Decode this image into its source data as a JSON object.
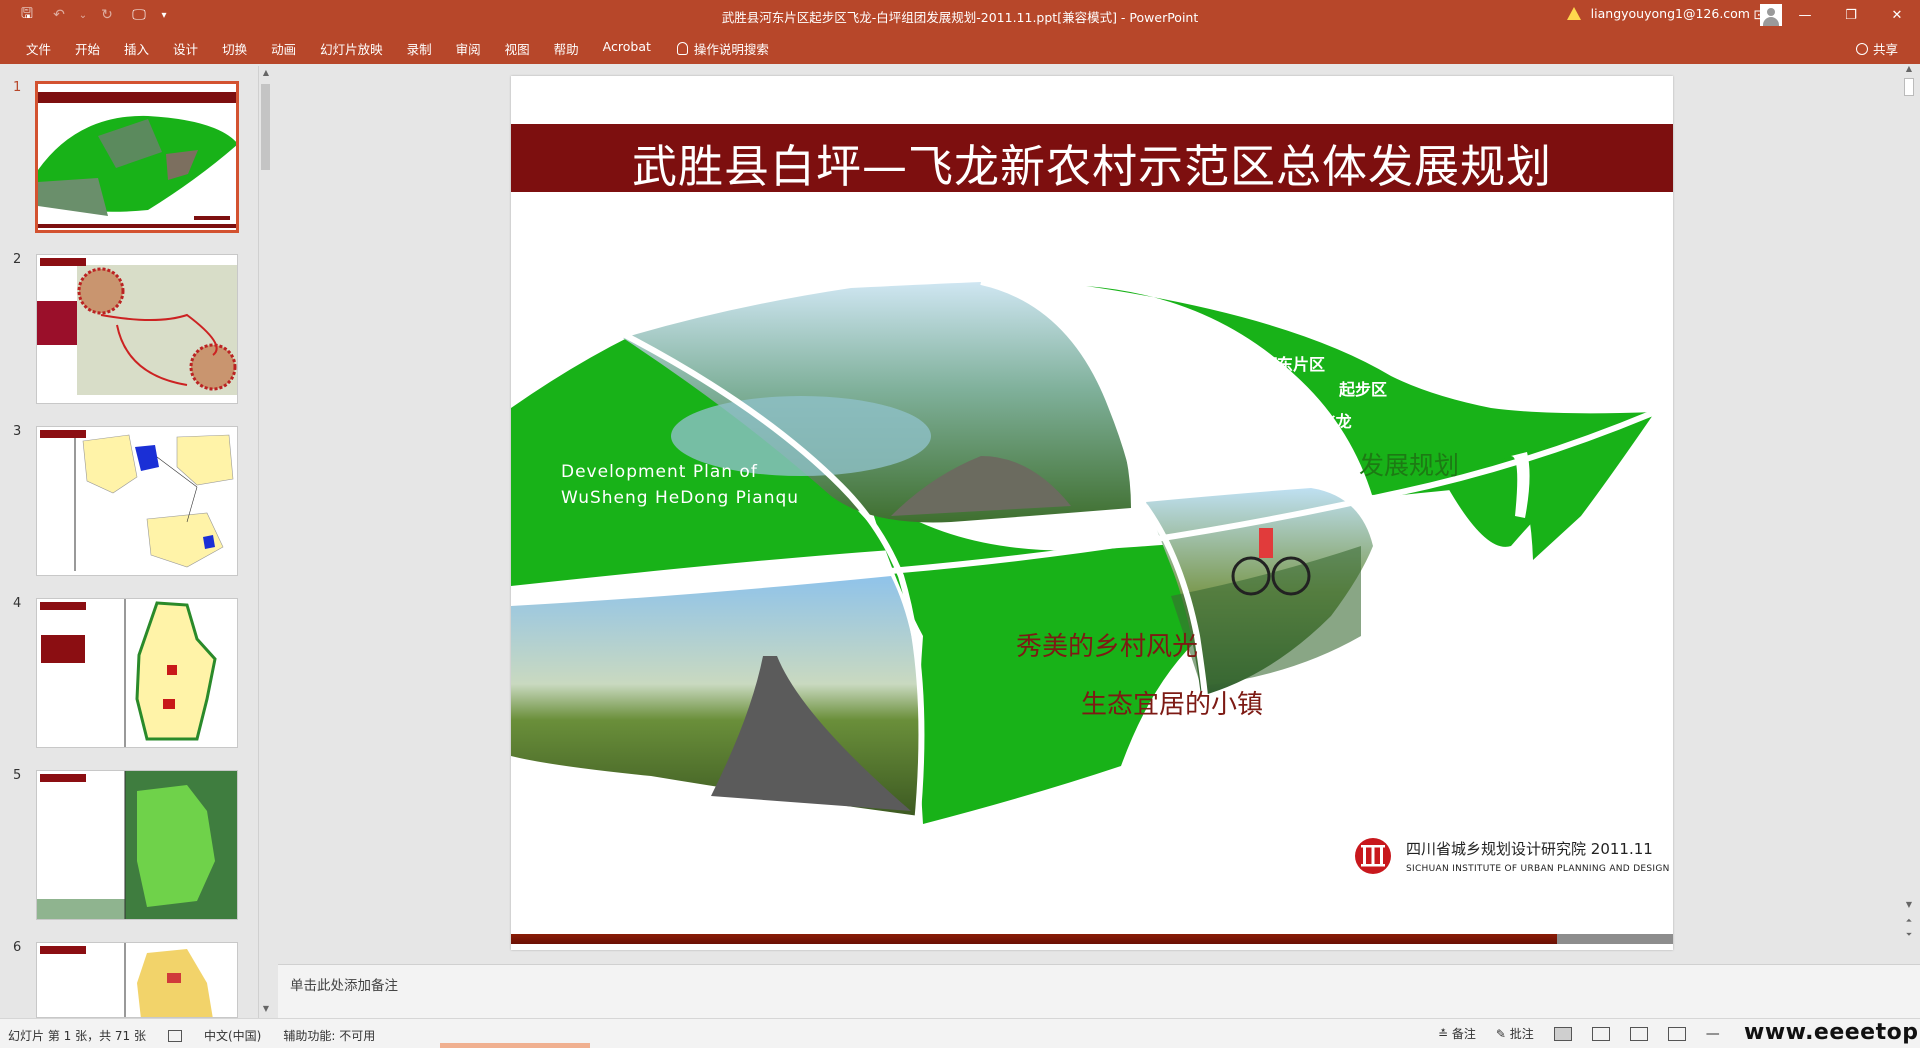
{
  "window": {
    "title": "武胜县河东片区起步区飞龙-白坪组团发展规划-2011.11.ppt[兼容模式] - PowerPoint",
    "account": "liangyouyong1@126.com",
    "controls": [
      "⊡",
      "—",
      "❐",
      "✕"
    ]
  },
  "qat": {
    "save": "🖫",
    "undo": "↶",
    "undo_more": "⌄",
    "redo": "↻",
    "from_beginning": "🖵",
    "customize": "▾"
  },
  "ribbon": {
    "tabs": [
      "文件",
      "开始",
      "插入",
      "设计",
      "切换",
      "动画",
      "幻灯片放映",
      "录制",
      "审阅",
      "视图",
      "帮助",
      "Acrobat"
    ],
    "tell_me": "操作说明搜索",
    "share": "共享"
  },
  "thumbnails": [
    {
      "num": "1",
      "selected": true
    },
    {
      "num": "2"
    },
    {
      "num": "3"
    },
    {
      "num": "4"
    },
    {
      "num": "5"
    },
    {
      "num": "6"
    }
  ],
  "slide": {
    "title": "武胜县白坪—飞龙新农村示范区总体发展规划",
    "en_line1": "Development  Plan  of",
    "en_line2": "WuSheng  HeDong  Pianqu",
    "cn_line1": "武胜县河东片区",
    "cn_line2": "起步区",
    "cn_line3": "白坪-飞龙",
    "cn_line4": "发展规划",
    "slogan1": "秀美的乡村风光",
    "slogan2": "生态宜居的小镇",
    "org": "四川省城乡规划设计研究院 2011.11",
    "org_en": "SICHUAN INSTITUTE OF URBAN PLANNING AND DESIGN",
    "colors": {
      "green": "#18b218",
      "banner": "#7d0f0f",
      "accent": "#b7472a"
    }
  },
  "notes": {
    "placeholder": "单击此处添加备注"
  },
  "status": {
    "slide_info": "幻灯片 第 1 张，共 71 张",
    "language": "中文(中国)",
    "accessibility": "辅助功能: 不可用",
    "notes": "备注",
    "comments": "批注",
    "zoom_minus": "—"
  },
  "watermark": "www.eeeetop.com"
}
